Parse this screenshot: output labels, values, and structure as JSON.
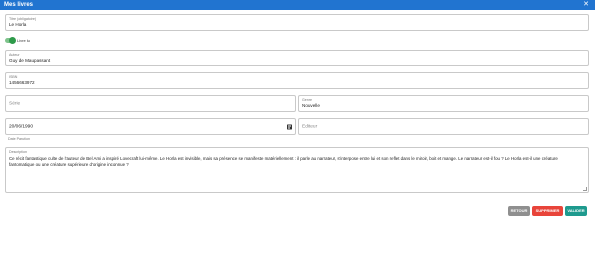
{
  "window": {
    "title": "Mes livres",
    "close_glyph": "✕"
  },
  "form": {
    "titre": {
      "label": "Titre (obligatoire)",
      "value": "Le Horla"
    },
    "lu_toggle": {
      "label": "Livre lu",
      "checked": true
    },
    "auteur": {
      "label": "Auteur",
      "value": "Guy de Maupassant"
    },
    "isbn": {
      "label": "ISBN",
      "value": "1456663972"
    },
    "serie": {
      "placeholder": "Série",
      "value": ""
    },
    "genre": {
      "label": "Genre",
      "value": "Nouvelle"
    },
    "date": {
      "value": "20/06/1990",
      "helper": "Date Parution"
    },
    "editeur": {
      "placeholder": "Editeur",
      "value": ""
    },
    "description": {
      "label": "Description",
      "value": "Ce récit fantastique culte de l'auteur de Bel Ami a inspiré Lovecraft lui-même. Le Horla est invisible, mais sa présence se manifeste matériellement : il parle au narrateur, s'interpose entre lui et son reflet dans le miroir, boit et mange. Le narrateur est-il fou ? Le Horla est-il une créature fantomatique ou une créature supérieure d'origine inconnue ?"
    }
  },
  "buttons": {
    "retour": "RETOUR",
    "supprimer": "SUPPRIMER",
    "valider": "VALIDER"
  },
  "colors": {
    "titlebar": "#2174d0",
    "toggle_on": "#2e9a4a",
    "retour": "#8f8f8f",
    "supprimer": "#e8443a",
    "valider": "#1e9a8e"
  },
  "icons": {
    "close": "close-icon",
    "calendar": "calendar-icon",
    "resize": "resize-handle-icon"
  }
}
